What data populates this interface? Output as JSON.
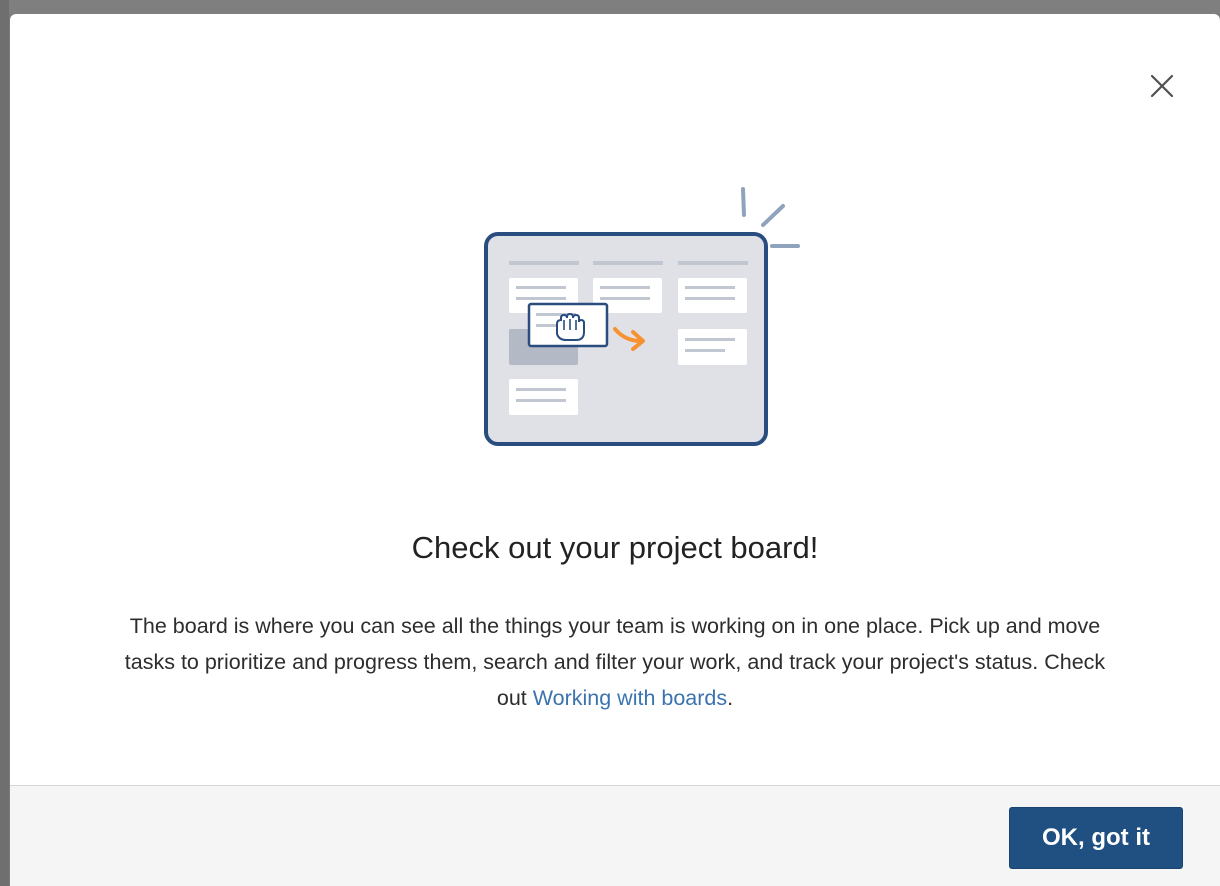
{
  "dialog": {
    "title": "Check out your project board!",
    "description_text": "The board is where you can see all the things your team is working on in one place. Pick up and move tasks to prioritize and progress them, search and filter your work, and track your project's status. Check out ",
    "link_text": "Working with boards",
    "description_end": ".",
    "close_icon": "close-icon",
    "illustration_icon": "board-drag-illustration"
  },
  "footer": {
    "ok_label": "OK, got it"
  },
  "colors": {
    "primary_button": "#205081",
    "link": "#3b73af",
    "illustration_border": "#2a4d7f",
    "illustration_fill": "#dfe1e6",
    "accent_arrow": "#f79232"
  }
}
